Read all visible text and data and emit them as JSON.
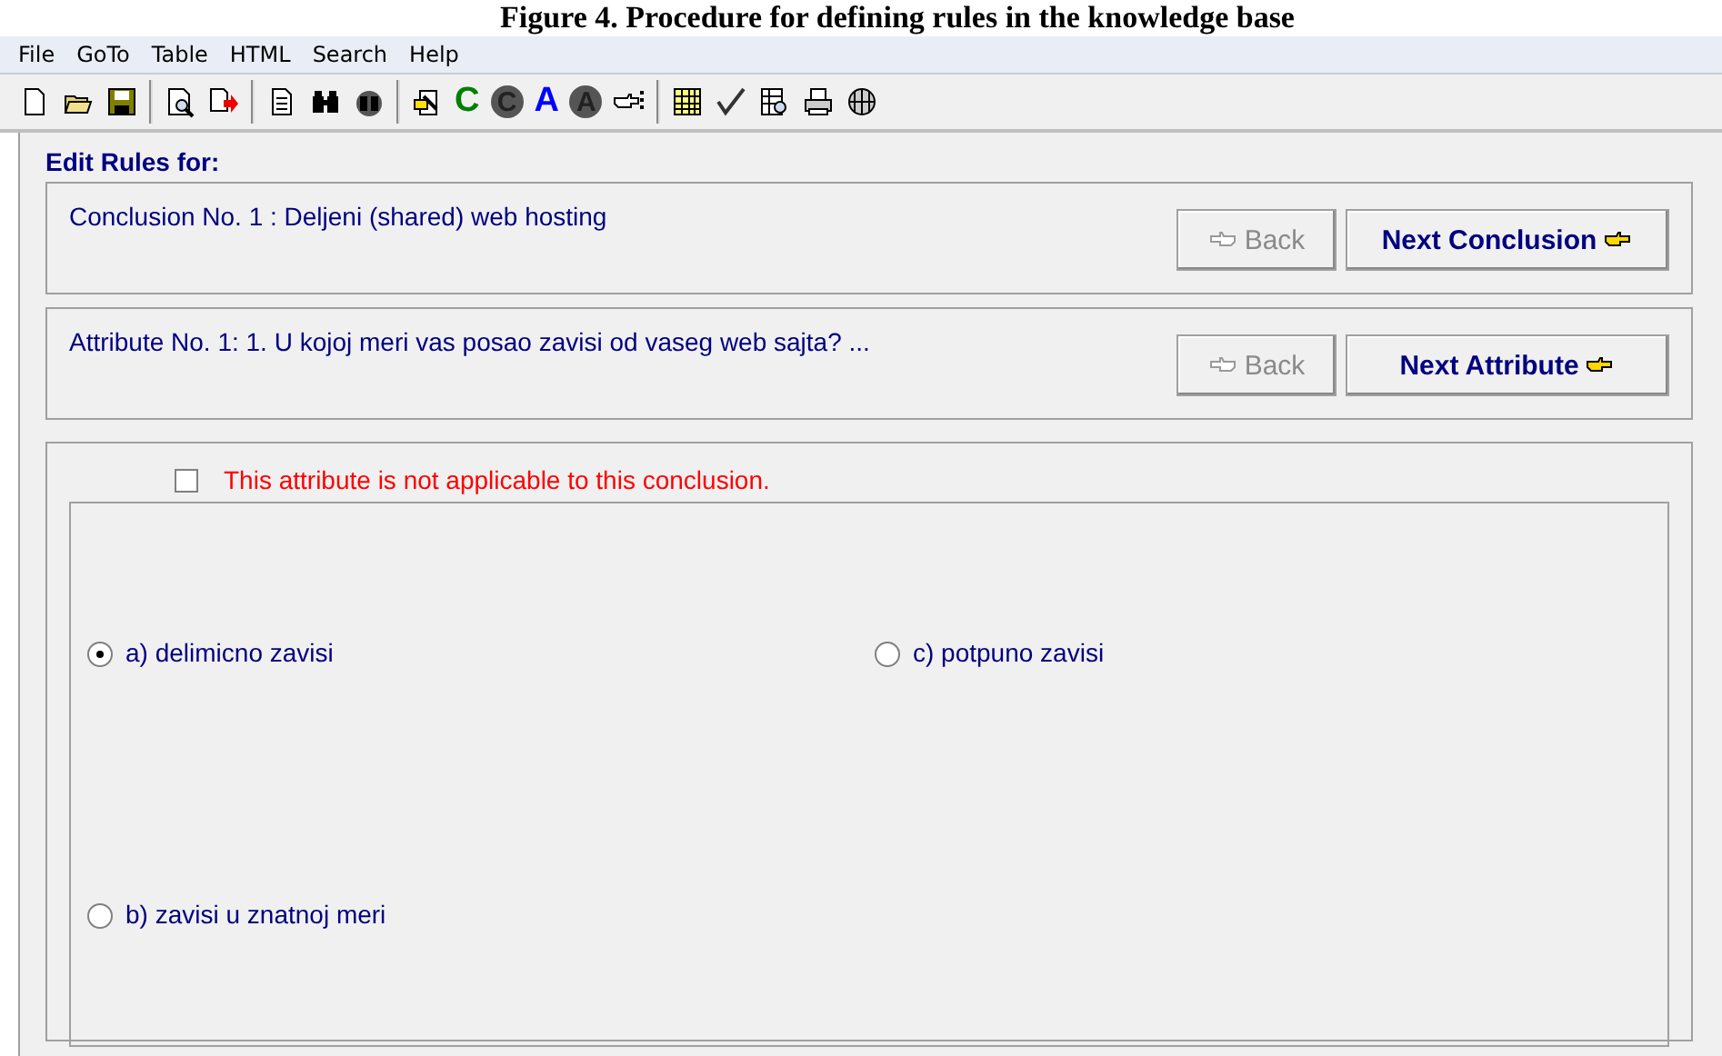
{
  "caption": "Figure 4. Procedure for defining rules in the knowledge base",
  "menu": [
    "File",
    "GoTo",
    "Table",
    "HTML",
    "Search",
    "Help"
  ],
  "toolbar_letters": [
    "C",
    "C",
    "A",
    "A"
  ],
  "heading": "Edit Rules for:",
  "rows": [
    {
      "text": "Conclusion No. 1 : Deljeni (shared) web hosting",
      "back": {
        "label": "Back",
        "disabled": true
      },
      "next": {
        "label": "Next Conclusion",
        "disabled": false
      }
    },
    {
      "text": "Attribute No. 1: 1. U kojoj meri vas posao zavisi od vaseg web sajta? ...",
      "back": {
        "label": "Back",
        "disabled": true
      },
      "next": {
        "label": "Next Attribute",
        "disabled": false
      }
    }
  ],
  "not_applicable": {
    "label": "This attribute is not applicable to this conclusion.",
    "checked": false
  },
  "options": [
    {
      "label": "a) delimicno zavisi",
      "selected": true
    },
    {
      "label": "c) potpuno zavisi",
      "selected": false
    },
    {
      "label": "b) zavisi u znatnoj meri",
      "selected": false
    }
  ]
}
